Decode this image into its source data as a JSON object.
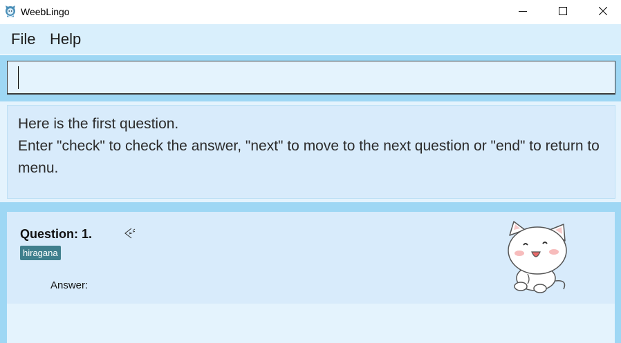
{
  "window": {
    "title": "WeebLingo",
    "app_icon": "weeblingo-app-icon",
    "controls": [
      "minimize-icon",
      "maximize-icon",
      "close-icon"
    ]
  },
  "menu": {
    "items": [
      {
        "label": "File"
      },
      {
        "label": "Help"
      }
    ]
  },
  "command": {
    "value": "",
    "placeholder": ""
  },
  "result": {
    "lines": [
      "Here is the first question.",
      "Enter \"check\" to check the answer, \"next\" to move to the next question or \"end\" to return to menu."
    ]
  },
  "question": {
    "title": "Question: 1.",
    "tag": "hiragana",
    "answer_label": "Answer:",
    "audio_icon": "speaker-icon",
    "illustration": "cat-mascot-image"
  },
  "colors": {
    "band": "#9ed7f4",
    "menubar": "#d9effc",
    "panel": "#d8ebfb",
    "input_bg": "#e4f3fd",
    "tag_bg": "#3f7f8d"
  }
}
